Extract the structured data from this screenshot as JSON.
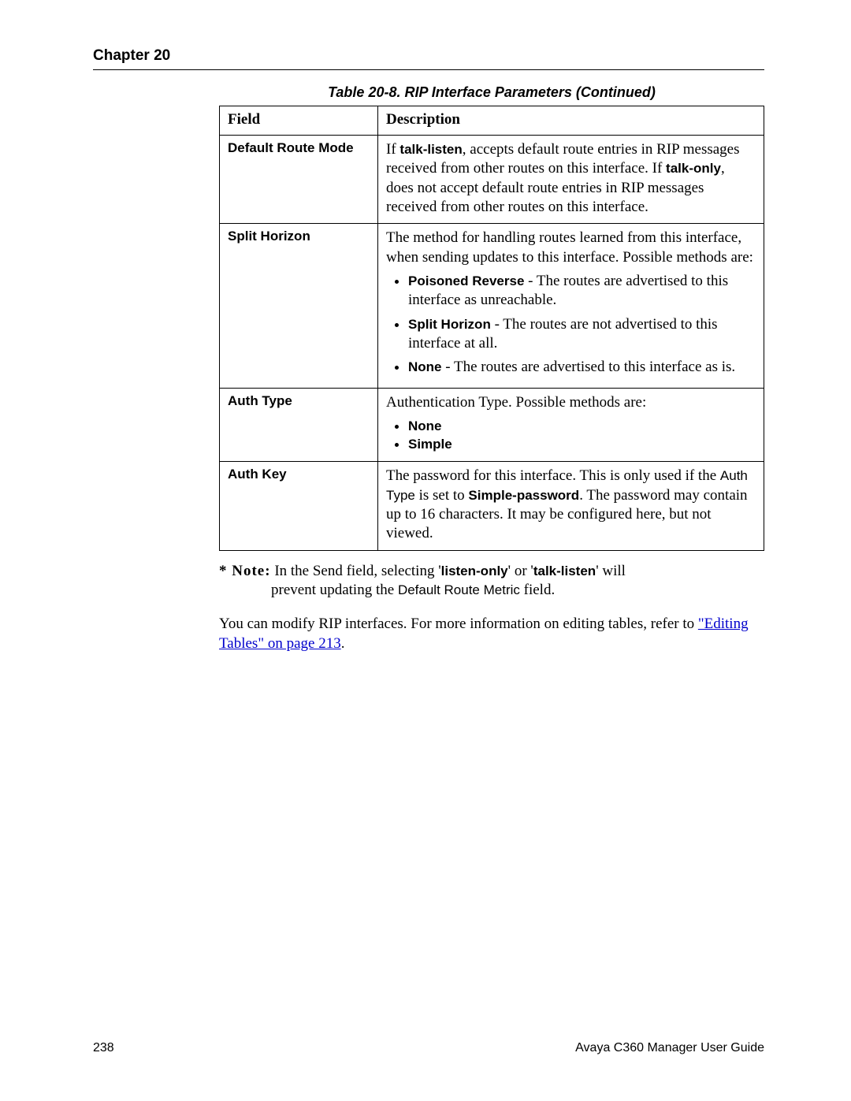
{
  "header": {
    "chapter": "Chapter 20"
  },
  "table": {
    "caption": "Table 20-8. RIP Interface Parameters (Continued)",
    "head": {
      "field": "Field",
      "description": "Description"
    },
    "rows": {
      "r0": {
        "field": "Default Route Mode",
        "d_pre1": "If ",
        "d_b1": "talk-listen",
        "d_mid1": ", accepts default route entries in RIP messages received from other routes on this interface. If ",
        "d_b2": "talk-only",
        "d_post1": ", does not accept default route entries in RIP messages received from other routes on this interface."
      },
      "r1": {
        "field": "Split Horizon",
        "intro": "The method for handling routes learned from this interface, when sending updates to this interface. Possible methods are:",
        "li0_b": "Poisoned Reverse",
        "li0_t": " - The routes are advertised to this interface as unreachable.",
        "li1_b": "Split Horizon",
        "li1_t": " - The routes are not advertised to this interface at all.",
        "li2_b": "None",
        "li2_t": " - The routes are advertised to this interface as is."
      },
      "r2": {
        "field": "Auth Type",
        "intro": "Authentication Type. Possible methods are:",
        "li0": "None",
        "li1": "Simple"
      },
      "r3": {
        "field": "Auth Key",
        "t0": "The password for this interface. This is only used if the ",
        "s0": "Auth Type",
        "t1": " is set to ",
        "s1": "Simple-password",
        "t2": ". The password may contain up to 16 characters. It may be configured here, but not viewed."
      }
    }
  },
  "note": {
    "label": "* Note:",
    "t0": " In the Send field, selecting '",
    "b0": "listen-only",
    "t1": "' or '",
    "b1": "talk-listen",
    "t2": "' will",
    "line2a": "prevent updating the ",
    "line2b": "Default Route Metric",
    "line2c": " field."
  },
  "para": {
    "t0": "You can modify RIP interfaces. For more information on editing tables, refer to ",
    "link": "\"Editing Tables\" on page 213",
    "t1": "."
  },
  "footer": {
    "page": "238",
    "title": "Avaya C360 Manager User Guide"
  }
}
